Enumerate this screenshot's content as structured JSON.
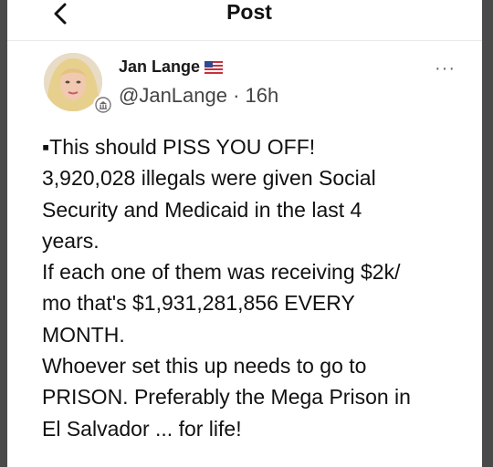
{
  "header": {
    "title": "Post"
  },
  "author": {
    "name": "Jan Lange",
    "flag_icon": "us-flag-icon",
    "handle": "@JanLange",
    "separator": " · ",
    "time": "16h"
  },
  "more_icon": "more-horizontal-icon",
  "post": {
    "lines": [
      "▪This should PISS YOU OFF!",
      "3,920,028 illegals were given Social",
      "Security and Medicaid in the last 4",
      "years.",
      "If each one of them was receiving $2k/",
      "mo that's $1,931,281,856 EVERY",
      "MONTH.",
      "Whoever set this up needs to go to",
      "PRISON. Preferably the Mega Prison in",
      "El Salvador ... for life!"
    ]
  }
}
